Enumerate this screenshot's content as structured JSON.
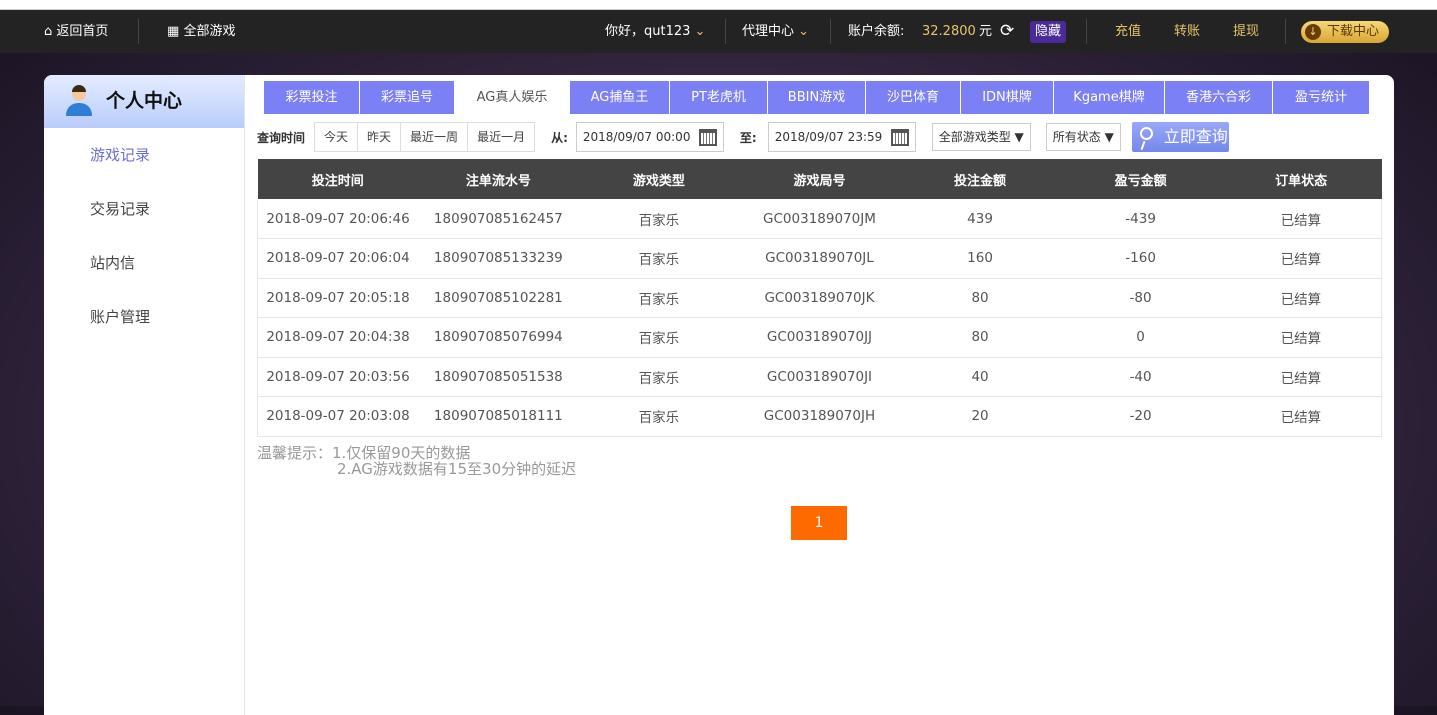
{
  "nav": {
    "home": "返回首页",
    "all_games": "全部游戏",
    "greeting": "你好，qut123",
    "agent": "代理中心",
    "balance_label": "账户余额:",
    "balance": "32.2800",
    "currency": "元",
    "hide": "隐藏",
    "deposit": "充值",
    "transfer": "转账",
    "withdraw": "提现",
    "download": "下载中心"
  },
  "sidebar": {
    "title": "个人中心",
    "items": [
      {
        "label": "游戏记录"
      },
      {
        "label": "交易记录"
      },
      {
        "label": "站内信"
      },
      {
        "label": "账户管理"
      }
    ]
  },
  "tabs": [
    "彩票投注",
    "彩票追号",
    "AG真人娱乐",
    "AG捕鱼王",
    "PT老虎机",
    "BBIN游戏",
    "沙巴体育",
    "IDN棋牌",
    "Kgame棋牌",
    "香港六合彩",
    "盈亏统计"
  ],
  "filter": {
    "label": "查询时间",
    "quick": [
      "今天",
      "昨天",
      "最近一周",
      "最近一月"
    ],
    "from_label": "从:",
    "from": "2018/09/07 00:00",
    "to_label": "至:",
    "to": "2018/09/07 23:59",
    "game_type": "全部游戏类型 ▼",
    "status": "所有状态 ▼",
    "search": "立即查询"
  },
  "table": {
    "headers": [
      "投注时间",
      "注单流水号",
      "游戏类型",
      "游戏局号",
      "投注金额",
      "盈亏金额",
      "订单状态"
    ],
    "rows": [
      [
        "2018-09-07 20:06:46",
        "180907085162457",
        "百家乐",
        "GC003189070JM",
        "439",
        "-439",
        "已结算"
      ],
      [
        "2018-09-07 20:06:04",
        "180907085133239",
        "百家乐",
        "GC003189070JL",
        "160",
        "-160",
        "已结算"
      ],
      [
        "2018-09-07 20:05:18",
        "180907085102281",
        "百家乐",
        "GC003189070JK",
        "80",
        "-80",
        "已结算"
      ],
      [
        "2018-09-07 20:04:38",
        "180907085076994",
        "百家乐",
        "GC003189070JJ",
        "80",
        "0",
        "已结算"
      ],
      [
        "2018-09-07 20:03:56",
        "180907085051538",
        "百家乐",
        "GC003189070JI",
        "40",
        "-40",
        "已结算"
      ],
      [
        "2018-09-07 20:03:08",
        "180907085018111",
        "百家乐",
        "GC003189070JH",
        "20",
        "-20",
        "已结算"
      ]
    ]
  },
  "notes": {
    "line1": "温馨提示：1.仅保留90天的数据",
    "line2": "2.AG游戏数据有15至30分钟的延迟"
  },
  "pagination": {
    "current": "1"
  }
}
